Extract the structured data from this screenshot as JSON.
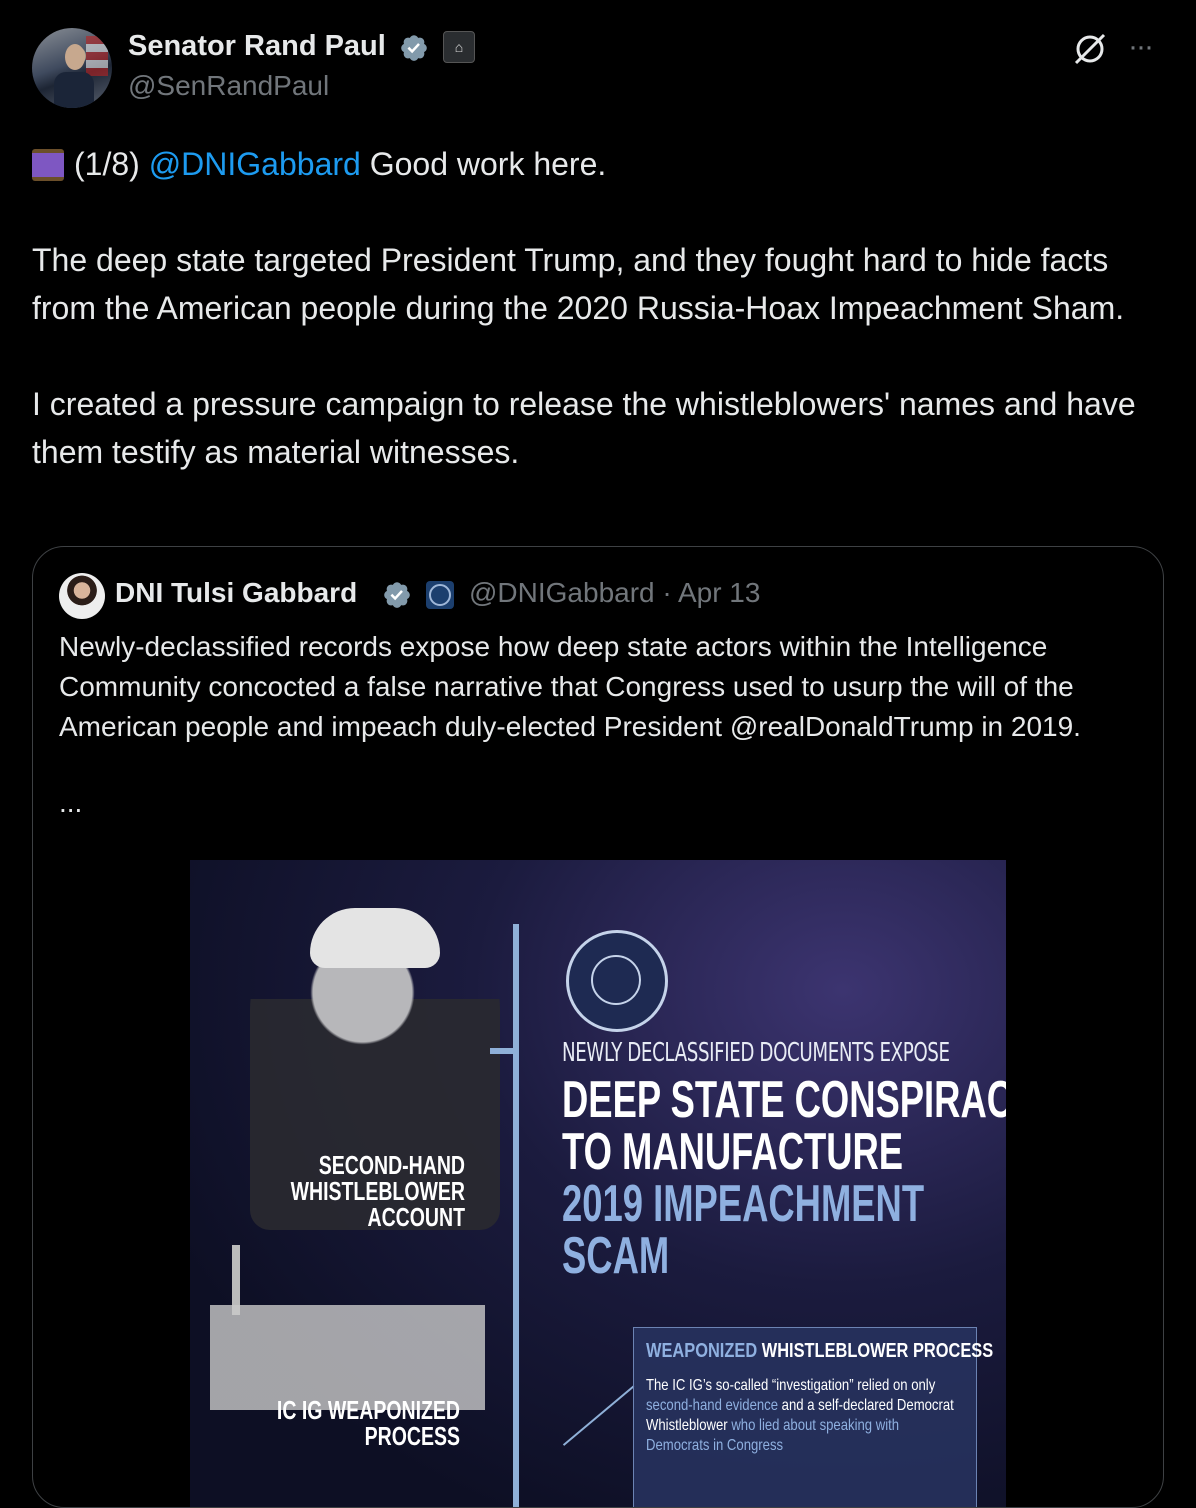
{
  "author": {
    "display_name": "Senator Rand Paul",
    "handle": "@SenRandPaul"
  },
  "icons": [
    "verified-badge-icon",
    "government-badge-icon",
    "grok-icon",
    "more-options-icon",
    "thread-emoji-icon"
  ],
  "tweet": {
    "line1_prefix": "(1/8)",
    "mention": "@DNIGabbard",
    "line1_suffix": "Good work here.",
    "para2": "The deep state targeted President Trump, and they fought hard to hide facts from the American people during the 2020 Russia-Hoax Impeachment Sham.",
    "para3": "I created a pressure campaign to release the whistleblowers' names and have them testify as material witnesses."
  },
  "quote": {
    "display_name": "DNI Tulsi Gabbard",
    "handle_date": "@DNIGabbard · Apr 13",
    "text": "Newly-declassified records expose how deep state actors within the Intelligence Community concocted a false narrative that Congress used to usurp the will of the American people and impeach duly-elected President @realDonaldTrump in 2019.",
    "ellipsis": "...",
    "media": {
      "kicker": "NEWLY DECLASSIFIED DOCUMENTS EXPOSE",
      "headline_line1": "DEEP STATE CONSPIRACY",
      "headline_line2": "TO MANUFACTURE",
      "headline_line3": "2019 IMPEACHMENT",
      "headline_line4": "SCAM",
      "label_top_1": "SECOND-HAND",
      "label_top_2": "WHISTLEBLOWER",
      "label_top_3": "ACCOUNT",
      "label_bottom_1": "IC IG WEAPONIZED",
      "label_bottom_2": "PROCESS",
      "panel_title_accent": "WEAPONIZED",
      "panel_title_rest": "WHISTLEBLOWER PROCESS",
      "panel_body_1": "The IC IG’s so-called “investigation” relied on only",
      "panel_body_hl1": "second-hand evidence",
      "panel_body_2": "and a self-declared Democrat Whistleblower",
      "panel_body_hl2": "who lied about speaking with Democrats in Congress"
    }
  },
  "colors": {
    "background": "#000000",
    "text": "#e7e9ea",
    "muted": "#71767b",
    "link": "#1d9bf0",
    "verified": "#829aab"
  }
}
